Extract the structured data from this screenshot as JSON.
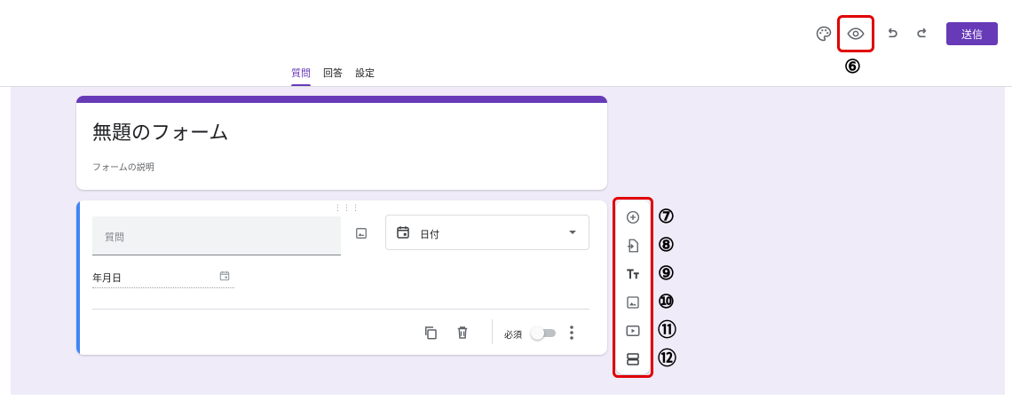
{
  "toolbar": {
    "icons": [
      "palette-icon",
      "preview-eye-icon",
      "undo-icon",
      "redo-icon"
    ],
    "send_label": "送信",
    "accent_color": "#673ab7"
  },
  "annotations": {
    "preview": "⑥",
    "sidebar": [
      "⑦",
      "⑧",
      "⑨",
      "⑩",
      "⑪",
      "⑫"
    ],
    "highlight_color": "#e00000"
  },
  "tabs": [
    {
      "label": "質問",
      "active": true
    },
    {
      "label": "回答",
      "active": false
    },
    {
      "label": "設定",
      "active": false
    }
  ],
  "form": {
    "title": "無題のフォーム",
    "description": "フォームの説明"
  },
  "question": {
    "placeholder": "質問",
    "type_label": "日付",
    "date_placeholder": "年月日",
    "required_label": "必須",
    "required_on": false,
    "left_bar_color": "#4285f4"
  },
  "sidebar_tools": [
    "add-question-icon",
    "import-questions-icon",
    "title-text-icon",
    "add-image-icon",
    "add-video-icon",
    "add-section-icon"
  ],
  "canvas_color": "#efebf8"
}
